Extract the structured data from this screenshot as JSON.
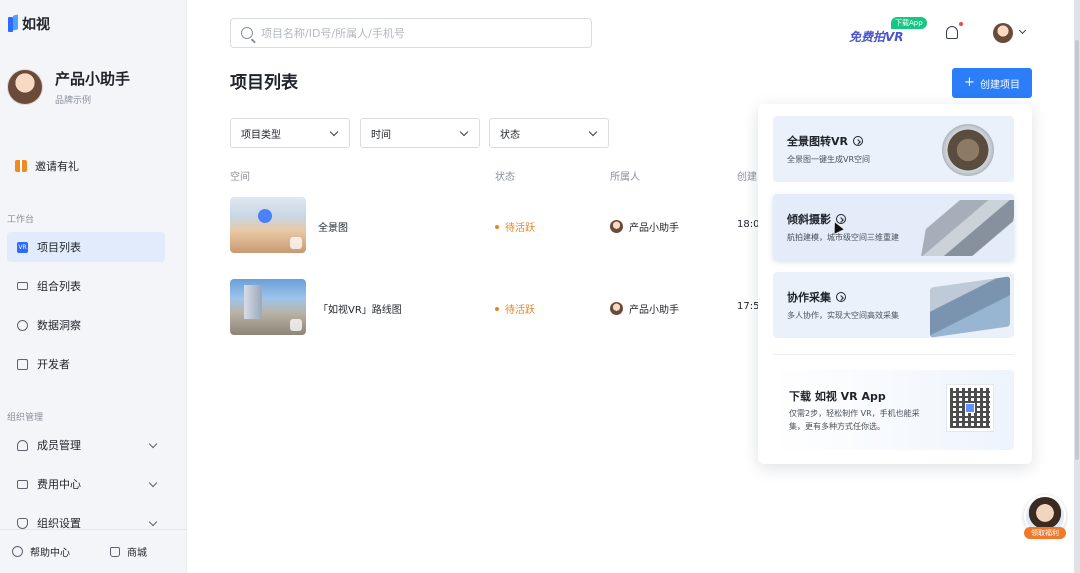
{
  "app": {
    "logo_text": "如视"
  },
  "profile": {
    "name": "产品小助手",
    "subtitle": "品牌示例"
  },
  "sidebar": {
    "invite_label": "邀请有礼",
    "workspace_label": "工作台",
    "org_label": "组织管理",
    "items": [
      {
        "label": "项目列表",
        "icon": "vr-icon"
      },
      {
        "label": "组合列表",
        "icon": "stack-icon"
      },
      {
        "label": "数据洞察",
        "icon": "pie-icon"
      },
      {
        "label": "开发者",
        "icon": "code-icon"
      }
    ],
    "org_items": [
      {
        "label": "成员管理",
        "icon": "users-icon"
      },
      {
        "label": "费用中心",
        "icon": "wallet-icon"
      },
      {
        "label": "组织设置",
        "icon": "shield-icon"
      }
    ],
    "footer": {
      "help": "帮助中心",
      "shop": "商城"
    }
  },
  "header": {
    "search_placeholder": "项目名称/ID号/所属人/手机号",
    "promo_text": "免费拍VR",
    "promo_badge": "下载App"
  },
  "main": {
    "title": "项目列表",
    "create_label": "创建项目",
    "filters": [
      "项目类型",
      "时间",
      "状态"
    ],
    "columns": [
      "空间",
      "状态",
      "所属人",
      "创建"
    ],
    "rows": [
      {
        "name": "全景图",
        "status": "待活跃",
        "owner": "产品小助手",
        "time": "18:0"
      },
      {
        "name": "「如视VR」路线图",
        "status": "待活跃",
        "owner": "产品小助手",
        "time": "17:5"
      }
    ]
  },
  "panel": {
    "cards": [
      {
        "title": "全景图转VR",
        "desc": "全景图一键生成VR空间"
      },
      {
        "title": "倾斜摄影",
        "desc": "航拍建模，城市级空间三维重建"
      },
      {
        "title": "协作采集",
        "desc": "多人协作，实现大空间高效采集"
      }
    ],
    "app": {
      "title": "下载 如视 VR App",
      "desc": "仅需2步，轻松制作 VR，手机也能采集，更有多种方式任你选。"
    }
  },
  "assistant": {
    "badge": "领取福利"
  },
  "colors": {
    "accent": "#2b7df8",
    "status": "#e8841d",
    "promo": "#4b55c8",
    "badge": "#16c784"
  }
}
